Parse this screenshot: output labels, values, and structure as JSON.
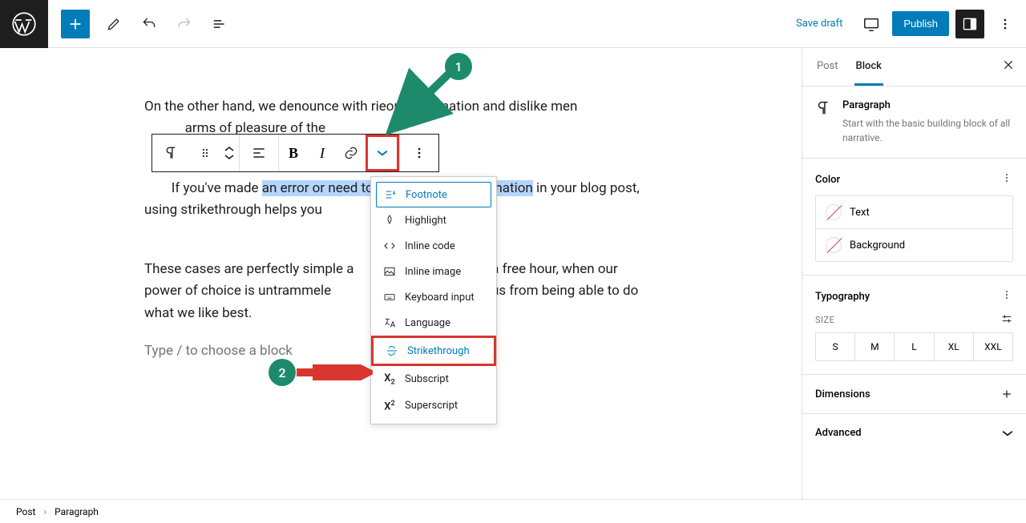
{
  "header": {
    "save_draft": "Save draft",
    "publish": "Publish"
  },
  "breadcrumb": {
    "root": "Post",
    "current": "Paragraph"
  },
  "content": {
    "p1_before": "On the other hand, we denounce with ri",
    "p1_mid": "eous indignation and dislike men ",
    "p1_after_prefix": "            ",
    "p1_after": "arms of pleasure of the",
    "p2_before": "If you've made ",
    "p2_sel1": "an error or need to ",
    "p2_gap": "                              ",
    "p2_sel2": "ormation",
    "p2_after": " in your blog post, using strikethrough helps you                               ncy.",
    "p3": "These cases are perfectly simple a                              sh. In a free hour, when our power of choice is untrammele                               prevents us from being able to do what we like best.",
    "placeholder": "Type / to choose a block"
  },
  "toolbar": {
    "bold": "B",
    "italic": "I"
  },
  "dropdown": {
    "items": [
      "Footnote",
      "Highlight",
      "Inline code",
      "Inline image",
      "Keyboard input",
      "Language",
      "Strikethrough",
      "Subscript",
      "Superscript"
    ]
  },
  "callouts": {
    "one": "1",
    "two": "2"
  },
  "sidebar": {
    "tab_post": "Post",
    "tab_block": "Block",
    "block_title": "Paragraph",
    "block_desc": "Start with the basic building block of all narrative.",
    "color_title": "Color",
    "color_text": "Text",
    "color_bg": "Background",
    "typo_title": "Typography",
    "size_label": "SIZE",
    "sizes": [
      "S",
      "M",
      "L",
      "XL",
      "XXL"
    ],
    "dim_title": "Dimensions",
    "adv_title": "Advanced"
  }
}
